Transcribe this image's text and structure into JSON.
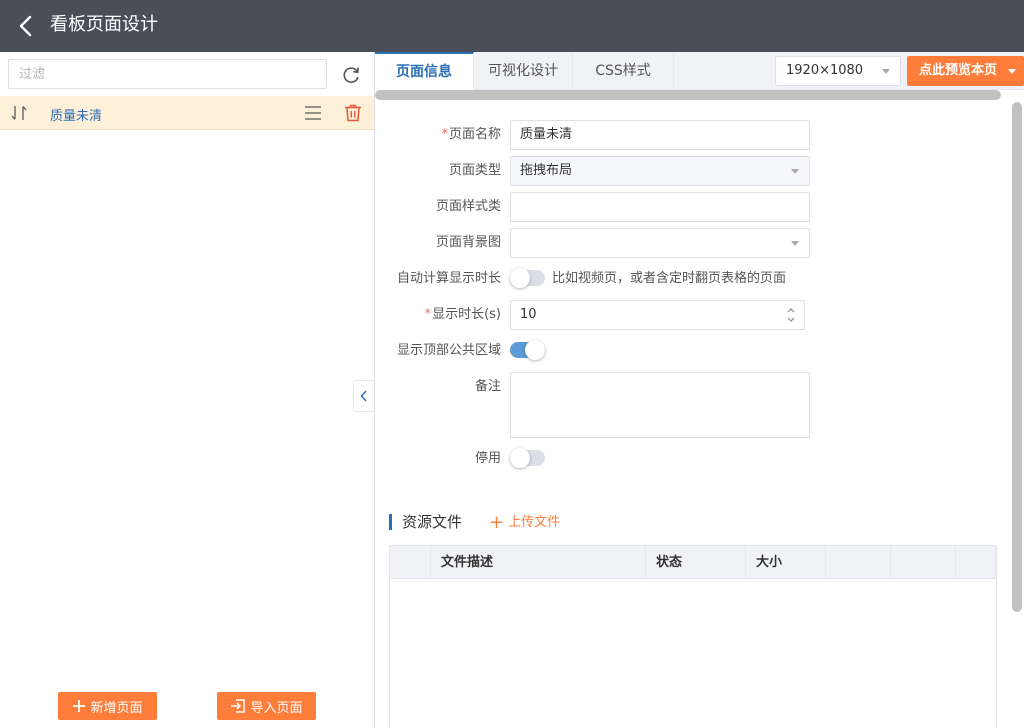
{
  "header": {
    "title": "看板页面设计"
  },
  "sidebar": {
    "filter_placeholder": "过滤",
    "pages": [
      {
        "name": "质量未清"
      }
    ],
    "add_button": "新增页面",
    "import_button": "导入页面"
  },
  "tabs": [
    {
      "label": "页面信息",
      "active": true
    },
    {
      "label": "可视化设计",
      "active": false
    },
    {
      "label": "CSS样式",
      "active": false
    }
  ],
  "toolbar": {
    "resolution": "1920×1080",
    "preview_button": "点此预览本页"
  },
  "form": {
    "page_name": {
      "label": "页面名称",
      "required": true,
      "value": "质量未清"
    },
    "page_type": {
      "label": "页面类型",
      "value": "拖拽布局"
    },
    "page_style_class": {
      "label": "页面样式类",
      "value": ""
    },
    "page_background": {
      "label": "页面背景图",
      "value": ""
    },
    "auto_duration": {
      "label": "自动计算显示时长",
      "on": false,
      "hint": "比如视频页，或者含定时翻页表格的页面"
    },
    "display_duration": {
      "label": "显示时长(s)",
      "required": true,
      "value": "10"
    },
    "show_header_area": {
      "label": "显示顶部公共区域",
      "on": true
    },
    "remark": {
      "label": "备注",
      "value": ""
    },
    "disabled": {
      "label": "停用",
      "on": false
    }
  },
  "resources": {
    "title": "资源文件",
    "upload_button": "上传文件",
    "columns": [
      "",
      "文件描述",
      "状态",
      "大小",
      "",
      "",
      ""
    ],
    "rows": []
  },
  "colors": {
    "header_bg": "#4a4f57",
    "accent_orange": "#ff7d3a",
    "accent_blue": "#2d6fb7",
    "selected_row_bg": "#fdf0d8",
    "switch_on": "#5b9bd5"
  }
}
